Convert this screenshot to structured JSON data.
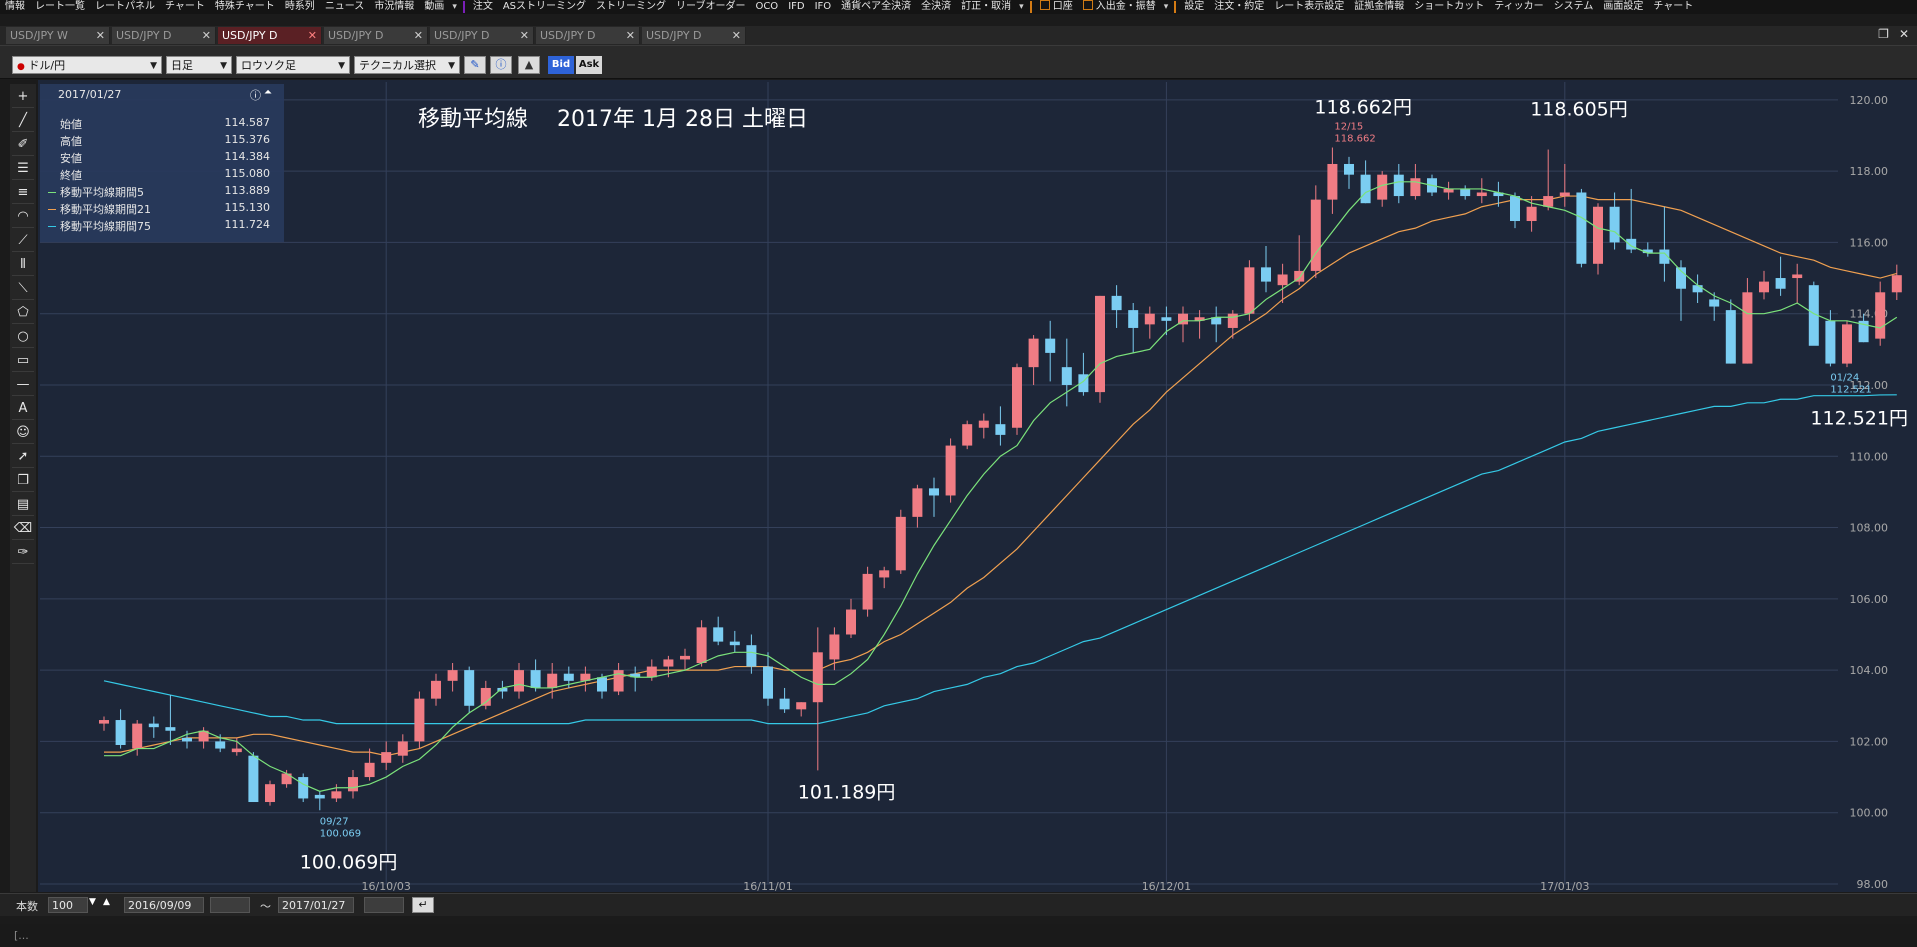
{
  "menu": [
    {
      "label": "情報"
    },
    {
      "label": "レート一覧"
    },
    {
      "label": "レートパネル"
    },
    {
      "label": "チャート"
    },
    {
      "label": "特殊チャート"
    },
    {
      "label": "時系列"
    },
    {
      "label": "ニュース"
    },
    {
      "label": "市況情報"
    },
    {
      "label": "動画"
    },
    {
      "label": "注文"
    },
    {
      "label": "ASストリーミング"
    },
    {
      "label": "ストリーミング"
    },
    {
      "label": "リーブオーダー"
    },
    {
      "label": "OCO"
    },
    {
      "label": "IFD"
    },
    {
      "label": "IFO"
    },
    {
      "label": "通貨ペア全決済"
    },
    {
      "label": "全決済"
    },
    {
      "label": "訂正・取消"
    },
    {
      "label": "口座"
    },
    {
      "label": "入出金・振替"
    },
    {
      "label": "設定"
    },
    {
      "label": "注文・約定"
    },
    {
      "label": "レート表示設定"
    },
    {
      "label": "証拠金情報"
    },
    {
      "label": "ショートカット"
    },
    {
      "label": "ティッカー"
    },
    {
      "label": "システム"
    },
    {
      "label": "画面設定"
    },
    {
      "label": "チャート"
    }
  ],
  "tabs": [
    {
      "label": "USD/JPY W"
    },
    {
      "label": "USD/JPY D"
    },
    {
      "label": "USD/JPY D"
    },
    {
      "label": "USD/JPY D"
    },
    {
      "label": "USD/JPY D"
    },
    {
      "label": "USD/JPY D"
    },
    {
      "label": "USD/JPY D"
    }
  ],
  "toolbar": {
    "pair": "ドル/円",
    "timeframe": "日足",
    "style": "ロウソク足",
    "technical": "テクニカル選択",
    "bid": "Bid",
    "ask": "Ask"
  },
  "info": {
    "date": "2017/01/27",
    "rows": [
      {
        "label": "始値",
        "value": "114.587",
        "color": ""
      },
      {
        "label": "高値",
        "value": "115.376",
        "color": ""
      },
      {
        "label": "安値",
        "value": "114.384",
        "color": ""
      },
      {
        "label": "終値",
        "value": "115.080",
        "color": ""
      },
      {
        "label": "移動平均線期間5",
        "value": "113.889",
        "color": "#7be27b"
      },
      {
        "label": "移動平均線期間21",
        "value": "115.130",
        "color": "#f0a050"
      },
      {
        "label": "移動平均線期間75",
        "value": "111.724",
        "color": "#35c9e6"
      }
    ]
  },
  "chart_data": {
    "type": "candlestick",
    "title": "移動平均線　 2017年 1月 28日 土曜日",
    "ylim": [
      98,
      120.5
    ],
    "y_ticks": [
      98,
      100,
      102,
      104,
      106,
      108,
      110,
      112,
      114,
      116,
      118,
      120
    ],
    "x_ticks": [
      {
        "index": 17,
        "label": "16/10/03"
      },
      {
        "index": 40,
        "label": "16/11/01"
      },
      {
        "index": 64,
        "label": "16/12/01"
      },
      {
        "index": 88,
        "label": "17/01/03"
      }
    ],
    "colors": {
      "up": "#f07c84",
      "down": "#7bcdf2",
      "ma5": "#7be27b",
      "ma21": "#f0a050",
      "ma75": "#35c9e6",
      "background": "#1d2638",
      "grid": "#34405a"
    },
    "candles": [
      [
        102.5,
        102.7,
        102.3,
        102.6
      ],
      [
        102.6,
        102.9,
        101.8,
        101.9
      ],
      [
        101.8,
        102.6,
        101.6,
        102.5
      ],
      [
        102.5,
        102.7,
        102.1,
        102.4
      ],
      [
        102.4,
        103.3,
        101.9,
        102.3
      ],
      [
        102.1,
        102.3,
        101.8,
        102.0
      ],
      [
        102.0,
        102.4,
        101.8,
        102.3
      ],
      [
        102.0,
        102.2,
        101.7,
        101.8
      ],
      [
        101.7,
        102.1,
        101.6,
        101.8
      ],
      [
        101.6,
        101.7,
        100.3,
        100.3
      ],
      [
        100.3,
        100.9,
        100.2,
        100.8
      ],
      [
        100.8,
        101.2,
        100.7,
        101.1
      ],
      [
        101.0,
        101.1,
        100.3,
        100.4
      ],
      [
        100.5,
        100.6,
        100.069,
        100.4
      ],
      [
        100.4,
        100.8,
        100.3,
        100.6
      ],
      [
        100.6,
        101.2,
        100.4,
        101.0
      ],
      [
        101.0,
        101.8,
        100.9,
        101.4
      ],
      [
        101.4,
        102.0,
        101.2,
        101.7
      ],
      [
        101.6,
        102.2,
        101.4,
        102.0
      ],
      [
        102.0,
        103.4,
        101.8,
        103.2
      ],
      [
        103.2,
        103.9,
        103.0,
        103.7
      ],
      [
        103.7,
        104.2,
        103.4,
        104.0
      ],
      [
        104.0,
        104.1,
        102.8,
        103.0
      ],
      [
        103.0,
        103.7,
        102.9,
        103.5
      ],
      [
        103.5,
        103.7,
        103.2,
        103.4
      ],
      [
        103.4,
        104.2,
        103.2,
        104.0
      ],
      [
        104.0,
        104.3,
        103.4,
        103.5
      ],
      [
        103.5,
        104.2,
        103.2,
        103.9
      ],
      [
        103.9,
        104.1,
        103.5,
        103.7
      ],
      [
        103.7,
        104.1,
        103.4,
        103.9
      ],
      [
        103.8,
        103.9,
        103.2,
        103.4
      ],
      [
        103.4,
        104.2,
        103.3,
        104.0
      ],
      [
        103.9,
        104.1,
        103.4,
        103.8
      ],
      [
        103.8,
        104.3,
        103.7,
        104.1
      ],
      [
        104.1,
        104.4,
        103.8,
        104.3
      ],
      [
        104.3,
        104.6,
        104.0,
        104.4
      ],
      [
        104.2,
        105.4,
        104.1,
        105.2
      ],
      [
        105.2,
        105.5,
        104.7,
        104.8
      ],
      [
        104.8,
        105.1,
        104.5,
        104.7
      ],
      [
        104.7,
        105.0,
        103.9,
        104.1
      ],
      [
        104.1,
        104.5,
        103.0,
        103.2
      ],
      [
        103.2,
        103.5,
        102.8,
        102.9
      ],
      [
        102.9,
        103.1,
        102.7,
        103.1
      ],
      [
        103.1,
        105.2,
        101.189,
        104.5
      ],
      [
        104.3,
        105.2,
        104.0,
        105.0
      ],
      [
        105.0,
        106.0,
        104.9,
        105.7
      ],
      [
        105.7,
        106.9,
        105.5,
        106.7
      ],
      [
        106.6,
        106.9,
        106.3,
        106.8
      ],
      [
        106.8,
        108.5,
        106.7,
        108.3
      ],
      [
        108.3,
        109.2,
        108.0,
        109.1
      ],
      [
        109.1,
        109.4,
        108.3,
        108.9
      ],
      [
        108.9,
        110.5,
        108.7,
        110.3
      ],
      [
        110.3,
        111.0,
        110.2,
        110.9
      ],
      [
        110.8,
        111.2,
        110.5,
        111.0
      ],
      [
        110.9,
        111.4,
        110.3,
        110.6
      ],
      [
        110.8,
        112.6,
        110.6,
        112.5
      ],
      [
        112.5,
        113.4,
        112.0,
        113.3
      ],
      [
        113.3,
        113.8,
        112.1,
        112.9
      ],
      [
        112.5,
        113.3,
        111.4,
        112.0
      ],
      [
        112.3,
        112.9,
        111.7,
        111.8
      ],
      [
        111.8,
        114.5,
        111.5,
        114.5
      ],
      [
        114.5,
        114.8,
        113.6,
        114.1
      ],
      [
        114.1,
        114.3,
        112.9,
        113.6
      ],
      [
        113.7,
        114.2,
        113.3,
        114.0
      ],
      [
        113.9,
        114.2,
        113.4,
        113.8
      ],
      [
        113.7,
        114.2,
        113.2,
        114.0
      ],
      [
        113.8,
        114.1,
        113.3,
        113.9
      ],
      [
        113.9,
        114.2,
        113.2,
        113.7
      ],
      [
        113.6,
        114.1,
        113.3,
        114.0
      ],
      [
        114.0,
        115.5,
        113.8,
        115.3
      ],
      [
        115.3,
        115.9,
        114.6,
        114.9
      ],
      [
        114.8,
        115.4,
        114.3,
        115.1
      ],
      [
        114.9,
        116.2,
        114.8,
        115.2
      ],
      [
        115.2,
        117.6,
        115.0,
        117.2
      ],
      [
        117.2,
        118.662,
        116.8,
        118.2
      ],
      [
        118.2,
        118.4,
        117.5,
        117.9
      ],
      [
        117.9,
        118.3,
        117.1,
        117.1
      ],
      [
        117.2,
        118.0,
        117.0,
        117.9
      ],
      [
        117.9,
        118.2,
        117.1,
        117.3
      ],
      [
        117.3,
        118.2,
        117.2,
        117.8
      ],
      [
        117.8,
        117.9,
        117.3,
        117.4
      ],
      [
        117.4,
        117.7,
        117.2,
        117.5
      ],
      [
        117.5,
        117.6,
        117.2,
        117.3
      ],
      [
        117.3,
        117.8,
        117.1,
        117.4
      ],
      [
        117.4,
        117.7,
        117.0,
        117.3
      ],
      [
        117.3,
        117.4,
        116.4,
        116.6
      ],
      [
        116.6,
        117.3,
        116.3,
        117.0
      ],
      [
        117.0,
        118.605,
        116.9,
        117.3
      ],
      [
        117.3,
        118.2,
        117.0,
        117.4
      ],
      [
        117.4,
        117.5,
        115.3,
        115.4
      ],
      [
        115.4,
        117.1,
        115.1,
        117.0
      ],
      [
        117.0,
        117.4,
        115.8,
        116.0
      ],
      [
        116.1,
        117.5,
        115.7,
        115.8
      ],
      [
        115.8,
        116.0,
        115.6,
        115.7
      ],
      [
        115.8,
        117.0,
        114.9,
        115.4
      ],
      [
        115.3,
        115.5,
        113.8,
        114.7
      ],
      [
        114.8,
        115.1,
        114.3,
        114.6
      ],
      [
        114.4,
        114.6,
        113.8,
        114.2
      ],
      [
        114.1,
        114.4,
        112.6,
        112.6
      ],
      [
        112.6,
        115.0,
        112.6,
        114.6
      ],
      [
        114.6,
        115.2,
        114.4,
        114.9
      ],
      [
        115.0,
        115.6,
        114.5,
        114.7
      ],
      [
        115.0,
        115.4,
        114.3,
        115.1
      ],
      [
        114.8,
        114.9,
        113.3,
        113.1
      ],
      [
        113.8,
        114.1,
        112.521,
        112.6
      ],
      [
        112.6,
        113.8,
        112.5,
        113.7
      ],
      [
        113.8,
        114.0,
        113.2,
        113.2
      ],
      [
        113.3,
        114.9,
        113.1,
        114.6
      ],
      [
        114.6,
        115.376,
        114.384,
        115.08
      ]
    ],
    "ma5": [
      101.6,
      101.6,
      101.8,
      101.8,
      102.0,
      102.2,
      102.3,
      102.1,
      102.0,
      101.6,
      101.3,
      101.1,
      100.8,
      100.6,
      100.7,
      100.7,
      100.8,
      101.0,
      101.3,
      101.5,
      101.9,
      102.4,
      102.8,
      103.1,
      103.5,
      103.6,
      103.5,
      103.5,
      103.6,
      103.7,
      103.8,
      103.9,
      103.8,
      103.8,
      103.9,
      104.0,
      104.2,
      104.4,
      104.5,
      104.5,
      104.4,
      104.1,
      103.8,
      103.6,
      103.6,
      103.9,
      104.3,
      105.0,
      105.8,
      106.7,
      107.5,
      108.2,
      108.9,
      109.5,
      110.0,
      110.3,
      111.0,
      111.5,
      111.8,
      112.1,
      112.6,
      112.8,
      112.9,
      113.0,
      113.5,
      113.8,
      113.8,
      113.9,
      113.9,
      114.0,
      114.4,
      114.7,
      115.0,
      115.7,
      116.3,
      116.9,
      117.4,
      117.6,
      117.7,
      117.7,
      117.6,
      117.5,
      117.5,
      117.5,
      117.4,
      117.3,
      117.1,
      117.0,
      116.9,
      116.7,
      116.4,
      116.3,
      115.9,
      115.7,
      115.7,
      115.2,
      114.8,
      114.5,
      114.3,
      114.0,
      114.0,
      114.1,
      114.3,
      114.0,
      113.8,
      113.8,
      113.7,
      113.6,
      113.9
    ],
    "ma21": [
      101.7,
      101.7,
      101.8,
      101.9,
      102.0,
      102.1,
      102.1,
      102.1,
      102.1,
      102.2,
      102.2,
      102.1,
      102.0,
      101.9,
      101.8,
      101.7,
      101.7,
      101.6,
      101.7,
      101.8,
      102.0,
      102.2,
      102.4,
      102.6,
      102.8,
      103.0,
      103.2,
      103.4,
      103.5,
      103.6,
      103.7,
      103.8,
      103.9,
      104.0,
      104.0,
      104.0,
      104.0,
      104.0,
      104.1,
      104.1,
      104.1,
      104.0,
      104.0,
      104.0,
      104.2,
      104.3,
      104.5,
      104.8,
      105.0,
      105.3,
      105.6,
      105.9,
      106.3,
      106.6,
      107.0,
      107.4,
      107.9,
      108.4,
      108.9,
      109.4,
      109.9,
      110.4,
      110.9,
      111.3,
      111.8,
      112.2,
      112.6,
      113.0,
      113.4,
      113.7,
      114.0,
      114.4,
      114.7,
      115.1,
      115.4,
      115.7,
      115.9,
      116.1,
      116.3,
      116.4,
      116.6,
      116.7,
      116.8,
      117.0,
      117.1,
      117.2,
      117.2,
      117.2,
      117.3,
      117.3,
      117.2,
      117.2,
      117.2,
      117.1,
      117.0,
      116.9,
      116.7,
      116.5,
      116.3,
      116.1,
      115.9,
      115.7,
      115.6,
      115.5,
      115.3,
      115.2,
      115.1,
      115.0,
      115.13
    ],
    "ma75": [
      103.7,
      103.6,
      103.5,
      103.4,
      103.3,
      103.2,
      103.1,
      103.0,
      102.9,
      102.8,
      102.7,
      102.7,
      102.6,
      102.6,
      102.5,
      102.5,
      102.5,
      102.5,
      102.5,
      102.5,
      102.5,
      102.5,
      102.5,
      102.5,
      102.5,
      102.5,
      102.5,
      102.5,
      102.5,
      102.6,
      102.6,
      102.6,
      102.6,
      102.6,
      102.6,
      102.6,
      102.6,
      102.6,
      102.6,
      102.6,
      102.5,
      102.5,
      102.5,
      102.5,
      102.6,
      102.7,
      102.8,
      103.0,
      103.1,
      103.2,
      103.4,
      103.5,
      103.6,
      103.8,
      103.9,
      104.1,
      104.2,
      104.4,
      104.6,
      104.8,
      104.9,
      105.1,
      105.3,
      105.5,
      105.7,
      105.9,
      106.1,
      106.3,
      106.5,
      106.7,
      106.9,
      107.1,
      107.3,
      107.5,
      107.7,
      107.9,
      108.1,
      108.3,
      108.5,
      108.7,
      108.9,
      109.1,
      109.3,
      109.5,
      109.6,
      109.8,
      110.0,
      110.2,
      110.4,
      110.5,
      110.7,
      110.8,
      110.9,
      111.0,
      111.1,
      111.2,
      111.3,
      111.4,
      111.4,
      111.5,
      111.5,
      111.6,
      111.6,
      111.7,
      111.7,
      111.7,
      111.7,
      111.72,
      111.724
    ],
    "annotations": [
      {
        "index": 13,
        "text": "09/27",
        "text2": "100.069",
        "big": "100.069円",
        "side": "below"
      },
      {
        "index": 43,
        "text": "",
        "text2": "",
        "big": "101.189円",
        "side": "below"
      },
      {
        "index": 74,
        "text": "12/15",
        "text2": "118.662",
        "big": "118.662円",
        "side": "above"
      },
      {
        "index": 87,
        "text": "",
        "text2": "",
        "big": "118.605円",
        "side": "above"
      },
      {
        "index": 104,
        "text": "01/24",
        "text2": "112.521",
        "big": "112.521円",
        "side": "below"
      }
    ]
  },
  "bottom": {
    "count_label": "本数",
    "count": "100",
    "from_date": "2016/09/09",
    "tilde": "～",
    "to_date": "2017/01/27"
  },
  "status": "[..."
}
